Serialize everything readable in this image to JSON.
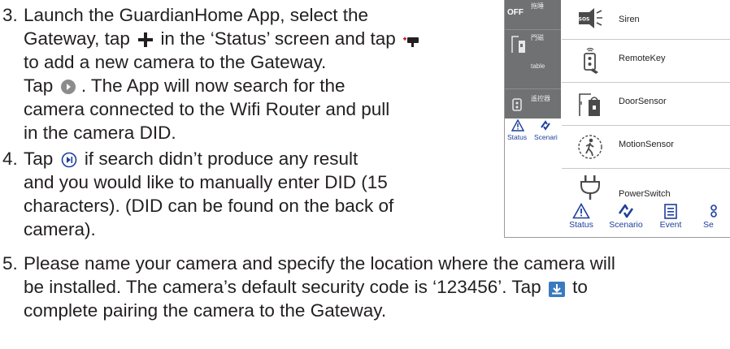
{
  "steps": [
    {
      "number": "3.",
      "lines": [
        "Launch the GuardianHome App, select the",
        "Gateway, tap",
        "in the ‘Status’ screen and tap",
        "to add a new camera to the Gateway.",
        "Tap",
        ". The App will now search for the",
        "camera connected to the Wifi Router and pull",
        "in the camera DID."
      ]
    },
    {
      "number": "4.",
      "lines": [
        "Tap",
        "if search didn’t produce any result",
        "and you would like to manually enter DID (15",
        "characters). (DID can be found on the back of",
        "camera)."
      ]
    },
    {
      "number": "5.",
      "lines": [
        "Please name your camera and specify the location where the camera will",
        "be installed. The camera’s default security code is ‘123456’. Tap",
        "to",
        "complete pairing the camera to the Gateway."
      ]
    }
  ],
  "phone": {
    "left_strip": {
      "off_label": "OFF",
      "off_sub": "拖睡",
      "door_label": "門磁",
      "door_sub": "table",
      "remote_label": "遙控器",
      "tab_status": "Status",
      "tab_scenario": "Scenari"
    },
    "devices": [
      {
        "label": "Siren",
        "icon": "siren-icon"
      },
      {
        "label": "RemoteKey",
        "icon": "remote-key-icon"
      },
      {
        "label": "DoorSensor",
        "icon": "door-sensor-icon"
      },
      {
        "label": "MotionSensor",
        "icon": "motion-sensor-icon"
      },
      {
        "label": "PowerSwitch",
        "icon": "power-switch-icon"
      }
    ],
    "tabs": [
      {
        "label": "Status",
        "icon": "warning-icon"
      },
      {
        "label": "Scenario",
        "icon": "scenario-icon"
      },
      {
        "label": "Event",
        "icon": "event-icon"
      },
      {
        "label": "Se",
        "icon": "settings-icon"
      }
    ]
  },
  "colors": {
    "text": "#231f20",
    "tab_blue": "#1d3f9c",
    "strip_gray": "#6f7172"
  }
}
